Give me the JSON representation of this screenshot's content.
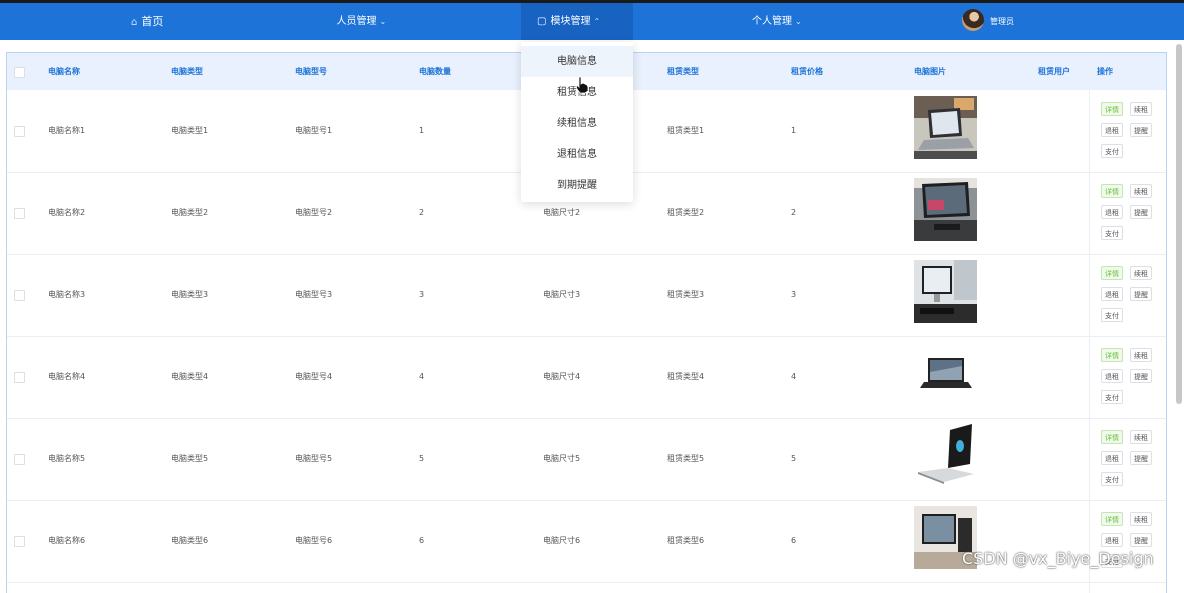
{
  "nav": {
    "items": [
      {
        "label": "首页",
        "icon": "home-icon"
      },
      {
        "label": "人员管理",
        "icon": "user-icon"
      },
      {
        "label": "模块管理",
        "icon": "module-icon"
      },
      {
        "label": "个人管理",
        "icon": ""
      }
    ],
    "admin_label": "管理员"
  },
  "dropdown": {
    "items": [
      "电脑信息",
      "租赁信息",
      "续租信息",
      "退租信息",
      "到期提醒"
    ]
  },
  "table": {
    "headers": [
      "电脑名称",
      "电脑类型",
      "电脑型号",
      "电脑数量",
      "",
      "租赁类型",
      "租赁价格",
      "电脑图片",
      "租赁用户",
      "操作"
    ],
    "rows": [
      {
        "name": "电脑名称1",
        "type": "电脑类型1",
        "model": "电脑型号1",
        "qty": "1",
        "size": "",
        "lease_type": "租赁类型1",
        "price": "1"
      },
      {
        "name": "电脑名称2",
        "type": "电脑类型2",
        "model": "电脑型号2",
        "qty": "2",
        "size": "电脑尺寸2",
        "lease_type": "租赁类型2",
        "price": "2"
      },
      {
        "name": "电脑名称3",
        "type": "电脑类型3",
        "model": "电脑型号3",
        "qty": "3",
        "size": "电脑尺寸3",
        "lease_type": "租赁类型3",
        "price": "3"
      },
      {
        "name": "电脑名称4",
        "type": "电脑类型4",
        "model": "电脑型号4",
        "qty": "4",
        "size": "电脑尺寸4",
        "lease_type": "租赁类型4",
        "price": "4"
      },
      {
        "name": "电脑名称5",
        "type": "电脑类型5",
        "model": "电脑型号5",
        "qty": "5",
        "size": "电脑尺寸5",
        "lease_type": "租赁类型5",
        "price": "5"
      },
      {
        "name": "电脑名称6",
        "type": "电脑类型6",
        "model": "电脑型号6",
        "qty": "6",
        "size": "电脑尺寸6",
        "lease_type": "租赁类型6",
        "price": "6"
      }
    ],
    "actions": {
      "detail": "详情",
      "renew": "续租",
      "return": "退租",
      "remind": "提醒",
      "pay": "支付"
    }
  },
  "watermark": "CSDN @vx_Biye_Design",
  "colors": {
    "primary": "#1e73d8",
    "header_bg": "#e8f1fd",
    "success": "#67c23a"
  }
}
